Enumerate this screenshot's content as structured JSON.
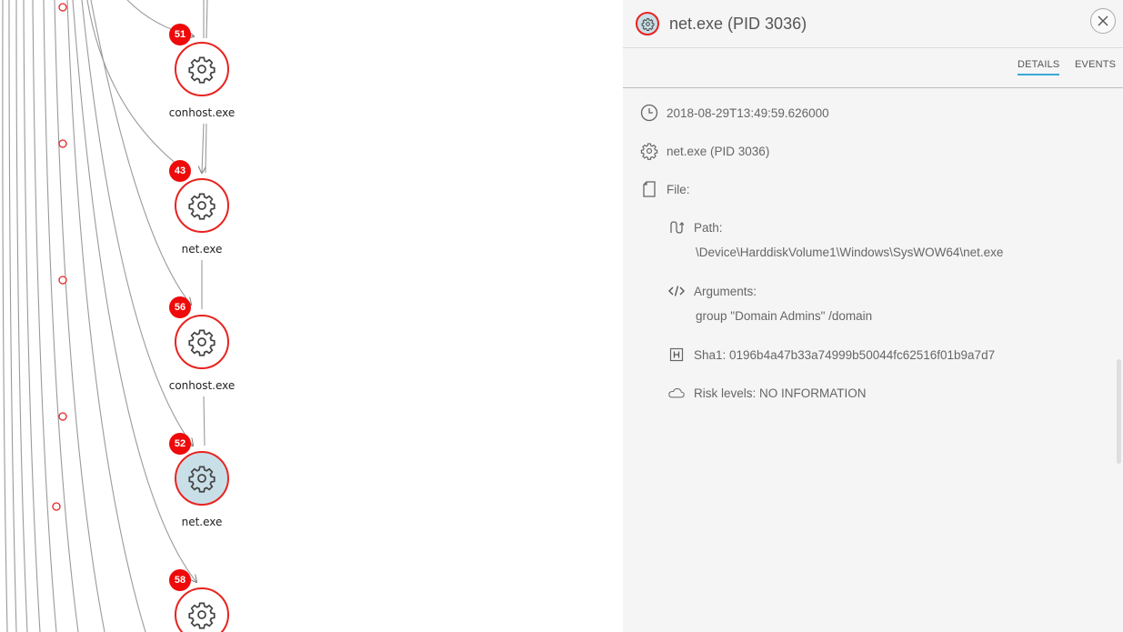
{
  "graph": {
    "nodes": [
      {
        "badge": "51",
        "label": "conhost.exe",
        "selected": false
      },
      {
        "badge": "43",
        "label": "net.exe",
        "selected": false
      },
      {
        "badge": "56",
        "label": "conhost.exe",
        "selected": false
      },
      {
        "badge": "52",
        "label": "net.exe",
        "selected": true
      },
      {
        "badge": "58",
        "label": "",
        "selected": false
      }
    ],
    "node_icon": "gear-icon",
    "accent_color": "#e8231f",
    "selected_fill": "#c9dfe7"
  },
  "panel": {
    "title": "net.exe (PID 3036)",
    "title_icon": "gear-icon",
    "close_icon": "close-icon",
    "tabs": [
      {
        "label": "DETAILS",
        "active": true
      },
      {
        "label": "EVENTS",
        "active": false
      }
    ],
    "details": {
      "timestamp": "2018-08-29T13:49:59.626000",
      "process": "net.exe (PID 3036)",
      "file_label": "File:",
      "path_label": "Path:",
      "path_value": "\\Device\\HarddiskVolume1\\Windows\\SysWOW64\\net.exe",
      "arguments_label": "Arguments:",
      "arguments_value": "group \"Domain Admins\" /domain",
      "sha1": "Sha1: 0196b4a47b33a74999b50044fc62516f01b9a7d7",
      "risk": "Risk levels: NO INFORMATION"
    },
    "icons": {
      "timestamp": "clock-icon",
      "process": "gear-icon",
      "file": "file-icon",
      "path": "path-icon",
      "arguments": "code-icon",
      "sha1": "hash-icon",
      "risk": "cloud-icon"
    },
    "tab_accent": "#3aa9d6"
  }
}
